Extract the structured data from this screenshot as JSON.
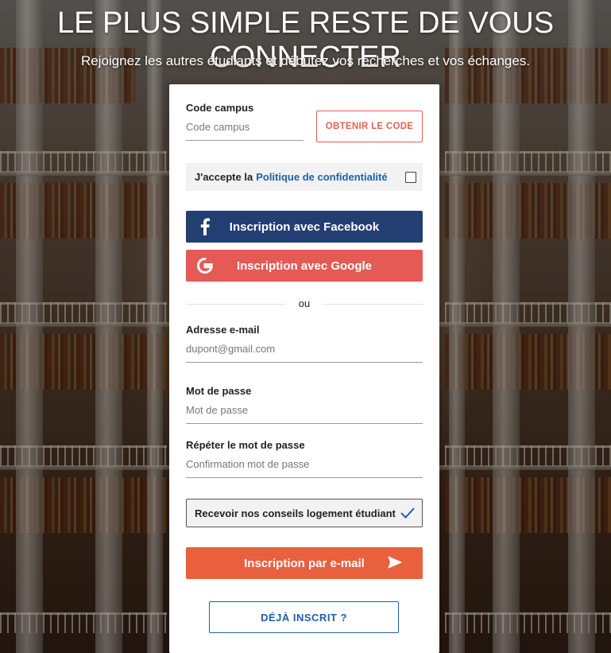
{
  "header": {
    "headline": "LE PLUS SIMPLE RESTE DE VOUS CONNECTER",
    "subline": "Rejoignez les autres étudiants et débutez vos recherches et vos échanges."
  },
  "form": {
    "campus": {
      "label": "Code campus",
      "placeholder": "Code campus",
      "button": "OBTENIR LE CODE"
    },
    "consent": {
      "prefix": "J'accepte la",
      "link": "Politique de confidentialité",
      "checked": false
    },
    "social": {
      "facebook": "Inscription avec Facebook",
      "google": "Inscription avec Google"
    },
    "divider": "ou",
    "email": {
      "label": "Adresse e-mail",
      "placeholder": "dupont@gmail.com"
    },
    "password": {
      "label": "Mot de passe",
      "placeholder": "Mot de passe"
    },
    "password_repeat": {
      "label": "Répéter le mot de passe",
      "placeholder": "Confirmation mot de passe"
    },
    "newsletter": {
      "label": "Recevoir nos conseils logement étudiant",
      "checked": true
    },
    "submit": "Inscription par e-mail",
    "login": "DÉJÀ INSCRIT ?"
  },
  "colors": {
    "accent_orange": "#e8603e",
    "facebook_blue": "#233e73",
    "google_red": "#e45a55",
    "link_blue": "#1e5fa8"
  },
  "icons": {
    "facebook": "facebook-icon",
    "google": "google-icon",
    "check": "checkmark-icon",
    "send": "send-icon"
  }
}
